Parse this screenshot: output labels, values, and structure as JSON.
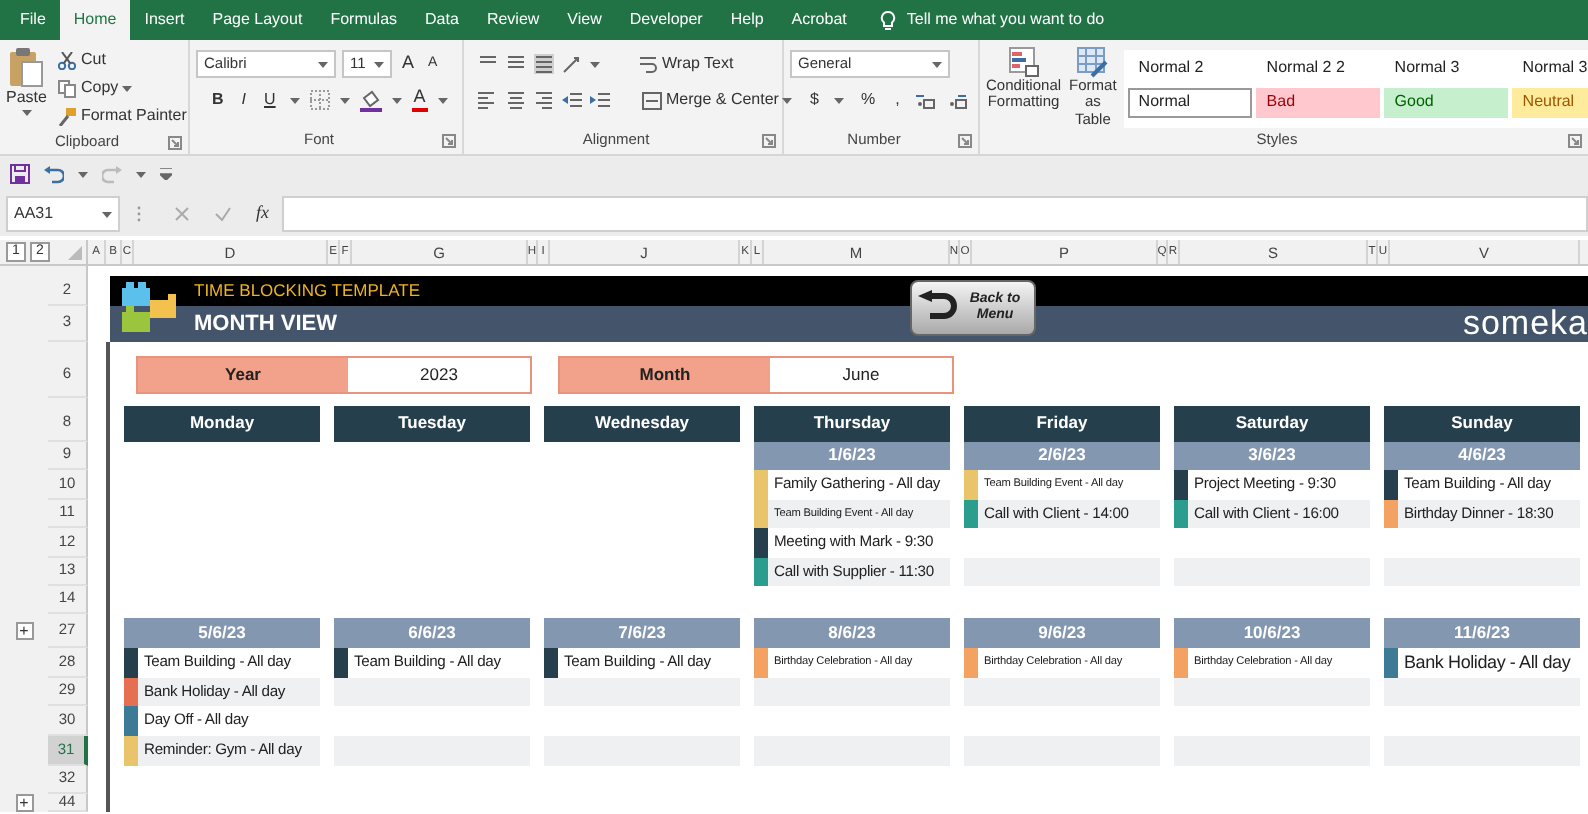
{
  "ribbon_tabs": [
    {
      "label": "File",
      "selected": false
    },
    {
      "label": "Home",
      "selected": true
    },
    {
      "label": "Insert",
      "selected": false
    },
    {
      "label": "Page Layout",
      "selected": false
    },
    {
      "label": "Formulas",
      "selected": false
    },
    {
      "label": "Data",
      "selected": false
    },
    {
      "label": "Review",
      "selected": false
    },
    {
      "label": "View",
      "selected": false
    },
    {
      "label": "Developer",
      "selected": false
    },
    {
      "label": "Help",
      "selected": false
    },
    {
      "label": "Acrobat",
      "selected": false
    }
  ],
  "tell_me": "Tell me what you want to do",
  "clipboard": {
    "paste": "Paste",
    "cut": "Cut",
    "copy": "Copy",
    "format_painter": "Format Painter",
    "label": "Clipboard"
  },
  "font": {
    "name": "Calibri",
    "size": "11",
    "grow": "A",
    "shrink": "A",
    "bold": "B",
    "italic": "I",
    "underline": "U",
    "font_color": "A",
    "label": "Font"
  },
  "alignment": {
    "wrap_text": "Wrap Text",
    "merge_center": "Merge & Center",
    "label": "Alignment"
  },
  "number": {
    "format": "General",
    "currency": "$",
    "percent": "%",
    "comma": ",",
    "label": "Number"
  },
  "styles": {
    "conditional_formatting": "Conditional Formatting",
    "format_as_table": "Format as Table",
    "label": "Styles",
    "gallery": [
      {
        "label": "Normal 2",
        "kind": "plain",
        "selected": false
      },
      {
        "label": "Normal 2 2",
        "kind": "plain",
        "selected": false
      },
      {
        "label": "Normal 3",
        "kind": "plain",
        "selected": false
      },
      {
        "label": "Normal 3",
        "kind": "plain",
        "selected": false
      },
      {
        "label": "Normal",
        "kind": "plain",
        "selected": true
      },
      {
        "label": "Bad",
        "kind": "bad",
        "selected": false
      },
      {
        "label": "Good",
        "kind": "good",
        "selected": false
      },
      {
        "label": "Neutral",
        "kind": "neutral",
        "selected": false
      }
    ]
  },
  "name_box": "AA31",
  "fx": "fx",
  "outline_levels": [
    "1",
    "2"
  ],
  "column_headers": [
    "A",
    "B",
    "C",
    "D",
    "E",
    "F",
    "G",
    "H",
    "I",
    "J",
    "K",
    "L",
    "M",
    "N",
    "O",
    "P",
    "Q",
    "R",
    "S",
    "T",
    "U",
    "V"
  ],
  "row_numbers": [
    {
      "label": "2",
      "selected": false
    },
    {
      "label": "3",
      "selected": false
    },
    {
      "label": "6",
      "selected": false
    },
    {
      "label": "8",
      "selected": false
    },
    {
      "label": "9",
      "selected": false
    },
    {
      "label": "10",
      "selected": false
    },
    {
      "label": "11",
      "selected": false
    },
    {
      "label": "12",
      "selected": false
    },
    {
      "label": "13",
      "selected": false
    },
    {
      "label": "14",
      "selected": false
    },
    {
      "label": "27",
      "selected": false
    },
    {
      "label": "28",
      "selected": false
    },
    {
      "label": "29",
      "selected": false
    },
    {
      "label": "30",
      "selected": false
    },
    {
      "label": "31",
      "selected": true
    },
    {
      "label": "32",
      "selected": false
    },
    {
      "label": "44",
      "selected": false
    }
  ],
  "outline_buttons": [
    "+",
    "+"
  ],
  "banner": {
    "title": "TIME BLOCKING TEMPLATE",
    "subtitle": "MONTH VIEW",
    "back_button": "Back to Menu",
    "logo": "someka"
  },
  "selectors": [
    {
      "label": "Year",
      "value": "2023"
    },
    {
      "label": "Month",
      "value": "June"
    }
  ],
  "weekdays": [
    "Monday",
    "Tuesday",
    "Wednesday",
    "Thursday",
    "Friday",
    "Saturday",
    "Sunday"
  ],
  "weeks": [
    {
      "days": [
        {
          "kind": "blank"
        },
        {
          "kind": "blank"
        },
        {
          "kind": "blank"
        },
        {
          "kind": "day",
          "date": "1/6/23",
          "slots": [
            {
              "kind": "event",
              "text": "Family Gathering - All day",
              "color": "#e9c46a"
            },
            {
              "kind": "minor",
              "text": "Team Building Event - All day",
              "color": "#e9c46a"
            },
            {
              "kind": "event",
              "text": "Meeting with Mark - 9:30",
              "color": "#263f4d"
            },
            {
              "kind": "event",
              "text": "Call with Supplier - 11:30",
              "color": "#2a9d8f"
            }
          ]
        },
        {
          "kind": "day",
          "date": "2/6/23",
          "slots": [
            {
              "kind": "minor",
              "text": "Team Building Event - All day",
              "color": "#e9c46a"
            },
            {
              "kind": "event",
              "text": "Call with Client - 14:00",
              "color": "#2a9d8f"
            },
            {
              "kind": "empty"
            },
            {
              "kind": "empty"
            }
          ]
        },
        {
          "kind": "day",
          "date": "3/6/23",
          "slots": [
            {
              "kind": "event",
              "text": "Project Meeting - 9:30",
              "color": "#263f4d"
            },
            {
              "kind": "event",
              "text": "Call with Client - 16:00",
              "color": "#2a9d8f"
            },
            {
              "kind": "empty"
            },
            {
              "kind": "empty"
            }
          ]
        },
        {
          "kind": "day",
          "date": "4/6/23",
          "slots": [
            {
              "kind": "event",
              "text": "Team Building - All day",
              "color": "#263f4d"
            },
            {
              "kind": "event",
              "text": "Birthday Dinner - 18:30",
              "color": "#f4a261"
            },
            {
              "kind": "empty"
            },
            {
              "kind": "empty"
            }
          ]
        }
      ]
    },
    {
      "days": [
        {
          "kind": "day",
          "date": "5/6/23",
          "slots": [
            {
              "kind": "event",
              "text": "Team Building - All day",
              "color": "#263f4d"
            },
            {
              "kind": "event",
              "text": "Bank Holiday - All day",
              "color": "#e76f51"
            },
            {
              "kind": "event",
              "text": "Day Off - All day",
              "color": "#3d7a96"
            },
            {
              "kind": "event",
              "text": "Reminder: Gym - All day",
              "color": "#e9c46a"
            }
          ]
        },
        {
          "kind": "day",
          "date": "6/6/23",
          "slots": [
            {
              "kind": "event",
              "text": "Team Building - All day",
              "color": "#263f4d"
            },
            {
              "kind": "empty"
            },
            {
              "kind": "empty"
            },
            {
              "kind": "empty"
            }
          ]
        },
        {
          "kind": "day",
          "date": "7/6/23",
          "slots": [
            {
              "kind": "event",
              "text": "Team Building - All day",
              "color": "#263f4d"
            },
            {
              "kind": "empty"
            },
            {
              "kind": "empty"
            },
            {
              "kind": "empty"
            }
          ]
        },
        {
          "kind": "day",
          "date": "8/6/23",
          "slots": [
            {
              "kind": "minor",
              "text": "Birthday Celebration - All day",
              "color": "#f4a261"
            },
            {
              "kind": "empty"
            },
            {
              "kind": "empty"
            },
            {
              "kind": "empty"
            }
          ]
        },
        {
          "kind": "day",
          "date": "9/6/23",
          "slots": [
            {
              "kind": "minor",
              "text": "Birthday Celebration - All day",
              "color": "#f4a261"
            },
            {
              "kind": "empty"
            },
            {
              "kind": "empty"
            },
            {
              "kind": "empty"
            }
          ]
        },
        {
          "kind": "day",
          "date": "10/6/23",
          "slots": [
            {
              "kind": "minor",
              "text": "Birthday Celebration - All day",
              "color": "#f4a261"
            },
            {
              "kind": "empty"
            },
            {
              "kind": "empty"
            },
            {
              "kind": "empty"
            }
          ]
        },
        {
          "kind": "day",
          "date": "11/6/23",
          "slots": [
            {
              "kind": "major",
              "text": "Bank Holiday - All day",
              "color": "#3d7a96"
            },
            {
              "kind": "empty"
            },
            {
              "kind": "empty"
            },
            {
              "kind": "empty"
            }
          ]
        }
      ]
    }
  ]
}
